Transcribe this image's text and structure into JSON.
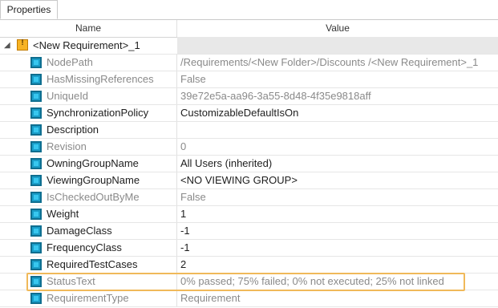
{
  "panel": {
    "tab_label": "Properties"
  },
  "columns": {
    "name": "Name",
    "value": "Value"
  },
  "root": {
    "expander": "◢",
    "label": "<New Requirement>_1"
  },
  "rows": [
    {
      "name": "NodePath",
      "value": "/Requirements/<New Folder>/Discounts /<New Requirement>_1",
      "readonly": true
    },
    {
      "name": "HasMissingReferences",
      "value": "False",
      "readonly": true
    },
    {
      "name": "UniqueId",
      "value": "39e72e5a-aa96-3a55-8d48-4f35e9818aff",
      "readonly": true
    },
    {
      "name": "SynchronizationPolicy",
      "value": "CustomizableDefaultIsOn",
      "readonly": false
    },
    {
      "name": "Description",
      "value": "",
      "readonly": false
    },
    {
      "name": "Revision",
      "value": "0",
      "readonly": true
    },
    {
      "name": "OwningGroupName",
      "value": "All Users (inherited)",
      "readonly": false
    },
    {
      "name": "ViewingGroupName",
      "value": "<NO VIEWING GROUP>",
      "readonly": false
    },
    {
      "name": "IsCheckedOutByMe",
      "value": "False",
      "readonly": true
    },
    {
      "name": "Weight",
      "value": "1",
      "readonly": false
    },
    {
      "name": "DamageClass",
      "value": "-1",
      "readonly": false
    },
    {
      "name": "FrequencyClass",
      "value": "-1",
      "readonly": false
    },
    {
      "name": "RequiredTestCases",
      "value": "2",
      "readonly": false
    },
    {
      "name": "StatusText",
      "value": "0% passed; 75% failed; 0% not executed; 25% not linked",
      "readonly": true,
      "highlighted": true
    },
    {
      "name": "RequirementType",
      "value": "Requirement",
      "readonly": true
    }
  ],
  "colors": {
    "highlight": "#f0b95a",
    "property_icon": "#1a9dc8",
    "warning_icon": "#f7b324"
  },
  "icons": {
    "root": "warning-icon",
    "property": "property-icon"
  }
}
